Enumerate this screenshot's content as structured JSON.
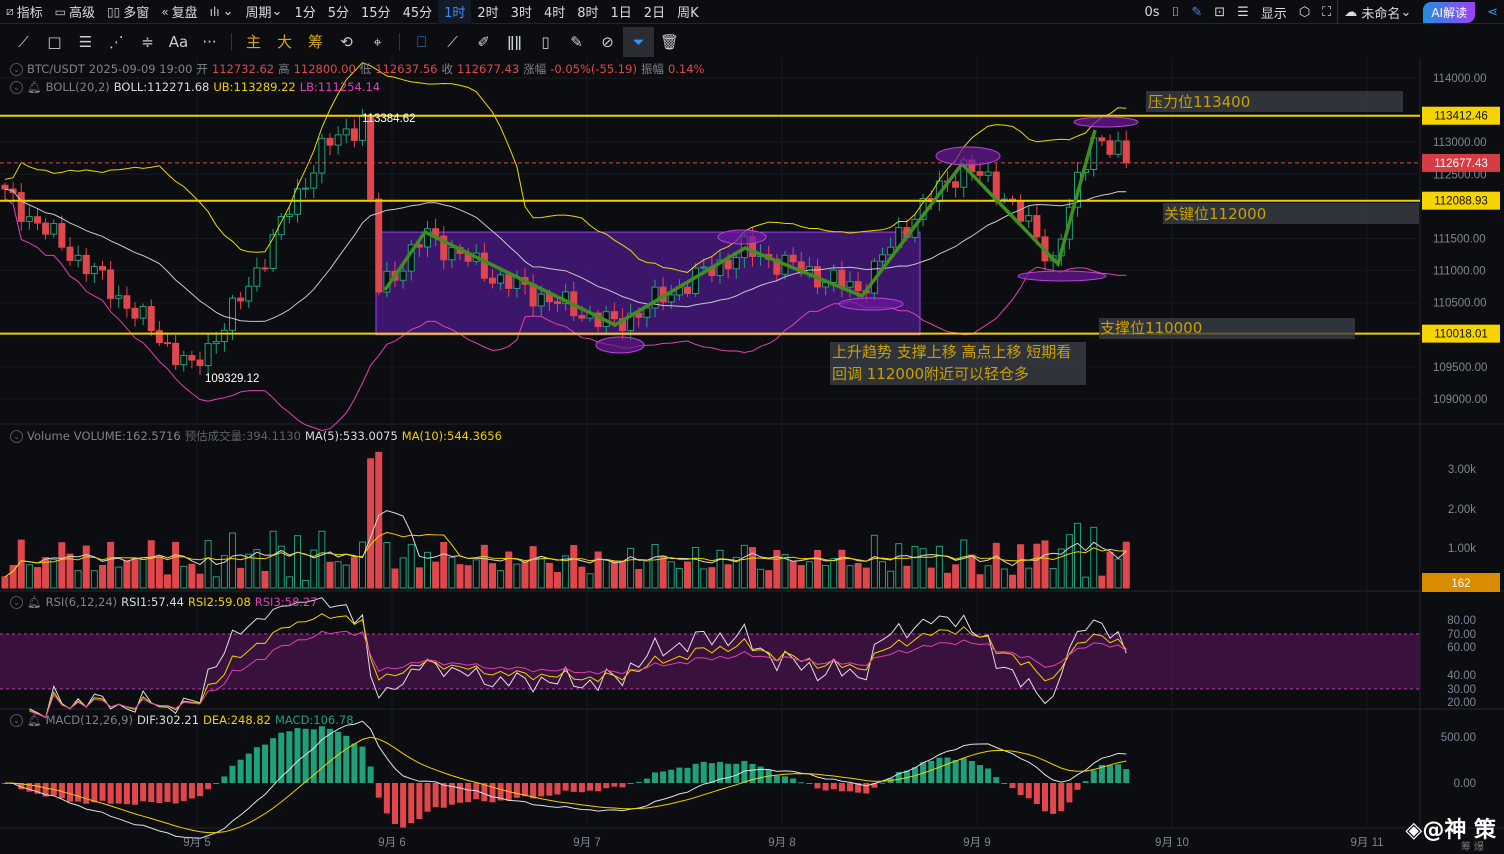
{
  "topbar": {
    "left": [
      {
        "icon": "chart-icon",
        "label": "指标"
      },
      {
        "icon": "template-icon",
        "label": "高级"
      },
      {
        "icon": "multi-window-icon",
        "label": "多窗"
      },
      {
        "icon": "replay-icon",
        "label": "复盘"
      }
    ],
    "chart_type_icon": "candles-icon",
    "period_label": "周期",
    "intervals": [
      "1分",
      "5分",
      "15分",
      "45分",
      "1时",
      "2时",
      "3时",
      "4时",
      "8时",
      "1日",
      "2日",
      "周K"
    ],
    "active_interval": "1时",
    "latency": "0s",
    "display_label": "显示",
    "layout_name": "未命名",
    "ai_label": "AI解读"
  },
  "drawbar": {
    "text_tool": "Aa",
    "more": "···",
    "main": "主",
    "big": "大",
    "chip": "筹"
  },
  "ohlc": {
    "symbol": "BTC/USDT",
    "time": "2025-09-09 19:00",
    "open_l": "开",
    "open": "112732.62",
    "high_l": "高",
    "high": "112800.00",
    "low_l": "低",
    "low": "112637.56",
    "close_l": "收",
    "close": "112677.43",
    "chg_l": "涨幅",
    "chg": "-0.05%(-55.19)",
    "amp_l": "振幅",
    "amp": "0.14%"
  },
  "boll": {
    "name": "BOLL(20,2)",
    "mid": "BOLL:112271.68",
    "ub": "UB:113289.22",
    "lb": "LB:111254.14"
  },
  "volume": {
    "name": "Volume",
    "value": "VOLUME:162.5716",
    "est": "预估成交量:394.1130",
    "ma5": "MA(5):533.0075",
    "ma10": "MA(10):544.3656",
    "tag": "162"
  },
  "rsi": {
    "name": "RSI(6,12,24)",
    "r1": "RSI1:57.44",
    "r2": "RSI2:59.08",
    "r3": "RSI3:58.27"
  },
  "macd": {
    "name": "MACD(12,26,9)",
    "dif": "DIF:302.21",
    "dea": "DEA:248.82",
    "macd": "MACD:106.78"
  },
  "price_axis": [
    "114000.00",
    "113000.00",
    "112500.00",
    "111500.00",
    "111000.00",
    "110500.00",
    "109500.00",
    "109000.00"
  ],
  "price_axis_values": [
    114000,
    113000,
    112500,
    111500,
    111000,
    110500,
    109500,
    109000
  ],
  "price_tags": [
    {
      "label": "113412.46",
      "value": 113412.46
    },
    {
      "label": "112088.93",
      "value": 112088.93
    },
    {
      "label": "110018.01",
      "value": 110018.01
    }
  ],
  "last_price": {
    "label": "112677.43",
    "value": 112677.43
  },
  "volume_axis": [
    "3.00k",
    "2.00k",
    "1.00k"
  ],
  "rsi_axis": [
    "80.00",
    "70.00",
    "60.00",
    "40.00",
    "30.00",
    "20.00"
  ],
  "macd_axis": [
    "500.00",
    "0.00"
  ],
  "dates": [
    "9月 5",
    "9月 6",
    "9月 7",
    "9月 8",
    "9月 9",
    "9月 10",
    "9月 11"
  ],
  "markers": {
    "high": "113384.62",
    "low": "109329.12"
  },
  "notes": {
    "resistance": "压力位113400",
    "key": "关键位112000",
    "support": "支撑位110000",
    "comment1": "上升趋势 支撑上移 高点上移 短期看",
    "comment2": "回调  112000附近可以轻仓多"
  },
  "watermark": {
    "text": "@神 策",
    "sub": "筹 爆"
  },
  "colors": {
    "up": "#1fa07a",
    "down": "#e0474c",
    "level": "#f0d000",
    "box": "#4b1a8a",
    "trend": "#3f8f1f"
  },
  "price_path": [
    [
      0,
      112180
    ],
    [
      12,
      110850
    ],
    [
      23,
      109450
    ],
    [
      29,
      110540
    ],
    [
      39,
      112880
    ],
    [
      44,
      113350
    ],
    [
      46,
      110700
    ],
    [
      52,
      111550
    ],
    [
      61,
      110850
    ],
    [
      75,
      110150
    ],
    [
      91,
      111320
    ],
    [
      105,
      110700
    ],
    [
      112,
      111870
    ],
    [
      118,
      112640
    ],
    [
      123,
      112180
    ],
    [
      129,
      111170
    ],
    [
      134,
      113110
    ],
    [
      138,
      112720
    ]
  ]
}
